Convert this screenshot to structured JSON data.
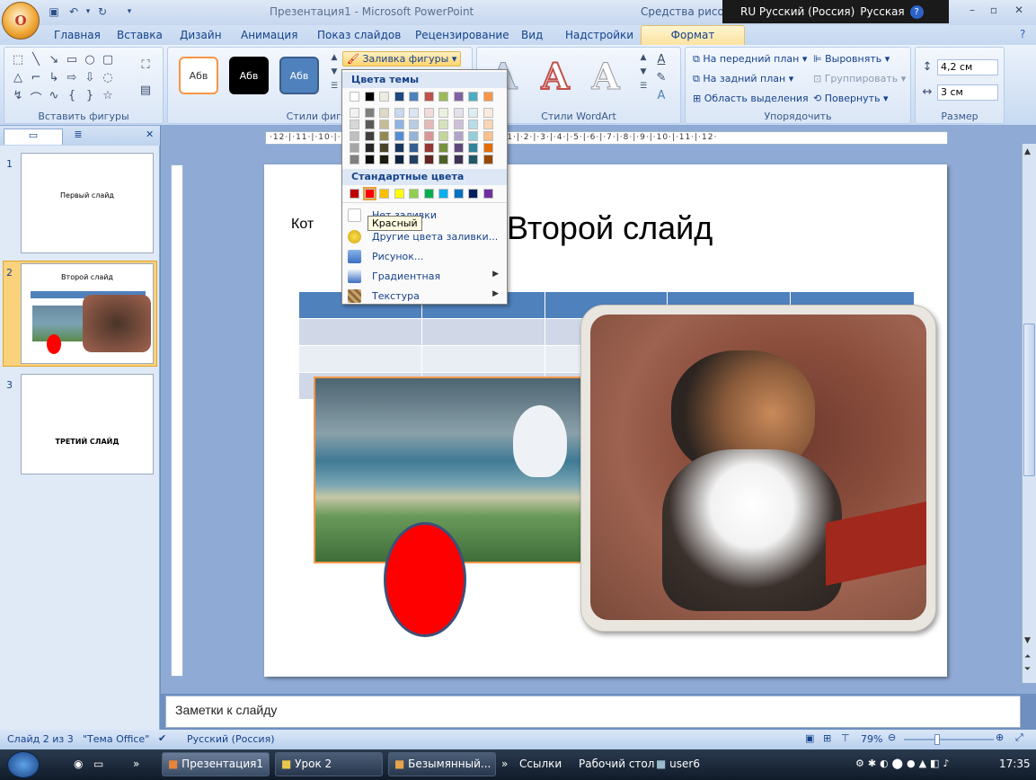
{
  "window": {
    "title": "Презентация1 - Microsoft PowerPoint",
    "contextual_title": "Средства рисования",
    "office_button": "O"
  },
  "language_bar": {
    "language": "RU Русский (Россия)",
    "keyboard": "Русская",
    "help": "?"
  },
  "tabs": [
    "Главная",
    "Вставка",
    "Дизайн",
    "Анимация",
    "Показ слайдов",
    "Рецензирование",
    "Вид",
    "Надстройки",
    "Формат"
  ],
  "ribbon": {
    "insert_shapes_label": "Вставить фигуры",
    "shape_styles_label": "Стили фигур",
    "style_sample": "Абв",
    "fill_button": "Заливка фигуры",
    "wordart_label": "Стили WordArt",
    "arrange": {
      "bring_front": "На передний план",
      "send_back": "На задний план",
      "selection_pane": "Область выделения",
      "align": "Выровнять",
      "group": "Группировать",
      "rotate": "Повернуть",
      "label": "Упорядочить"
    },
    "size": {
      "height": "4,2 см",
      "width": "3 см",
      "label": "Размер"
    }
  },
  "fill_menu": {
    "theme_colors_title": "Цвета темы",
    "standard_colors_title": "Стандартные цвета",
    "theme_colors": [
      "#ffffff",
      "#000000",
      "#eeece1",
      "#1f497d",
      "#4f81bd",
      "#c0504d",
      "#9bbb59",
      "#8064a2",
      "#4bacc6",
      "#f79646"
    ],
    "theme_shades": [
      [
        "#f2f2f2",
        "#7f7f7f",
        "#ddd9c3",
        "#c6d9f0",
        "#dbe5f1",
        "#f2dcdb",
        "#ebf1dd",
        "#e5e0ec",
        "#dbeef3",
        "#fdeada"
      ],
      [
        "#d8d8d8",
        "#595959",
        "#c4bd97",
        "#8db3e2",
        "#b8cce4",
        "#e5b9b7",
        "#d7e3bc",
        "#ccc1d9",
        "#b7dde8",
        "#fbd5b5"
      ],
      [
        "#bfbfbf",
        "#3f3f3f",
        "#938953",
        "#548dd4",
        "#95b3d7",
        "#d99694",
        "#c3d69b",
        "#b2a2c7",
        "#92cddc",
        "#fac08f"
      ],
      [
        "#a5a5a5",
        "#262626",
        "#494429",
        "#17365d",
        "#366092",
        "#953734",
        "#76923c",
        "#5f497a",
        "#31859b",
        "#e36c09"
      ],
      [
        "#7f7f7f",
        "#0c0c0c",
        "#1d1b10",
        "#0f243e",
        "#244061",
        "#632423",
        "#4f6128",
        "#3f3151",
        "#205867",
        "#974806"
      ]
    ],
    "standard_colors": [
      "#c00000",
      "#ff0000",
      "#ffc000",
      "#ffff00",
      "#92d050",
      "#00b050",
      "#00b0f0",
      "#0070c0",
      "#002060",
      "#7030a0"
    ],
    "no_fill": "Нет заливки",
    "more_colors": "Другие цвета заливки...",
    "picture": "Рисунок...",
    "gradient": "Градиентная",
    "texture": "Текстура",
    "tooltip": "Красный"
  },
  "slides_panel": {
    "slides": [
      {
        "num": "1",
        "title": "Первый слайд"
      },
      {
        "num": "2",
        "title": "Второй слайд"
      },
      {
        "num": "3",
        "title": "ТРЕТИЙ СЛАЙД"
      }
    ]
  },
  "slide": {
    "title": "Второй слайд",
    "text_box": "Кот",
    "shape_color": "#ff0000"
  },
  "ruler": "·12·|·11·|·10·|·9·|·8·|·7·|·6·|·5·|·4·|·3·|·2·|·1·|·0·|·1·|·2·|·3·|·4·|·5·|·6·|·7·|·8·|·9·|·10·|·11·|·12·",
  "notes": {
    "placeholder": "Заметки к слайду"
  },
  "status": {
    "slide": "Слайд 2 из 3",
    "theme": "\"Тема Office\"",
    "language": "Русский (Россия)",
    "zoom": "79%"
  },
  "taskbar": {
    "items": [
      "Презентация1",
      "Урок 2",
      "Безымянный...",
      "Ссылки",
      "Рабочий стол",
      "user6"
    ],
    "clock": "17:35"
  }
}
